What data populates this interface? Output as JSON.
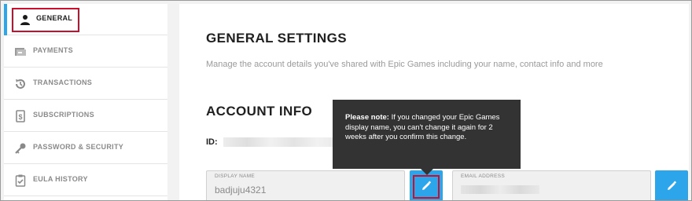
{
  "sidebar": {
    "items": [
      {
        "label": "GENERAL",
        "icon": "person-icon",
        "active": true
      },
      {
        "label": "PAYMENTS",
        "icon": "payments-icon"
      },
      {
        "label": "TRANSACTIONS",
        "icon": "history-icon"
      },
      {
        "label": "SUBSCRIPTIONS",
        "icon": "subscriptions-icon"
      },
      {
        "label": "PASSWORD & SECURITY",
        "icon": "key-icon"
      },
      {
        "label": "EULA HISTORY",
        "icon": "clipboard-check-icon"
      }
    ]
  },
  "main": {
    "title": "GENERAL SETTINGS",
    "subtitle": "Manage the account details you've shared with Epic Games including your name, contact info and more",
    "account_title": "ACCOUNT INFO",
    "id_label": "ID:",
    "display_name": {
      "label": "DISPLAY NAME",
      "value": "badjuju4321"
    },
    "email": {
      "label": "EMAIL ADDRESS"
    },
    "tooltip": {
      "bold": "Please note:",
      "text": " If you changed your Epic Games display name, you can't change it again for 2 weeks after you confirm this change."
    }
  },
  "colors": {
    "accent": "#2da5ea",
    "highlight": "#c8102e",
    "tooltip_bg": "#333333"
  }
}
